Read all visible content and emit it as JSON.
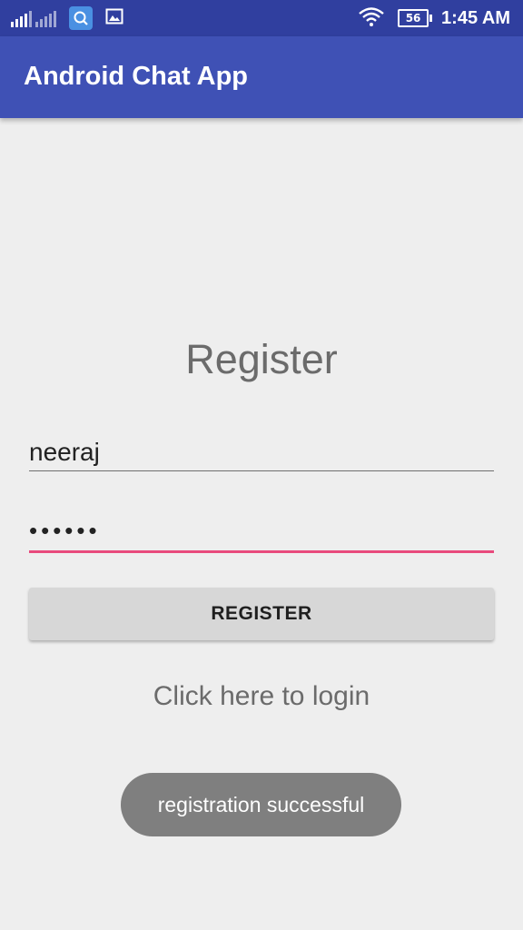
{
  "status_bar": {
    "time": "1:45 AM",
    "battery_level": "56",
    "icons": [
      "signal-icon",
      "signal-icon",
      "search-app-icon",
      "image-icon",
      "wifi-icon",
      "battery-icon"
    ]
  },
  "app_bar": {
    "title": "Android Chat App"
  },
  "form": {
    "heading": "Register",
    "username_value": "neeraj",
    "password_value": "••••••",
    "register_button_label": "REGISTER",
    "login_link": "Click here to login"
  },
  "toast": {
    "message": "registration successful"
  },
  "colors": {
    "status_bar": "#303f9f",
    "app_bar": "#3f51b5",
    "accent": "#e84a7c",
    "background": "#eeeeee"
  }
}
